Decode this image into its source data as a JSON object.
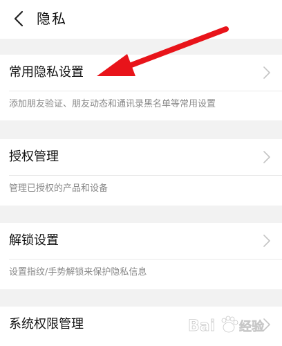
{
  "header": {
    "back_icon": "chevron-left-icon",
    "title": "隐私"
  },
  "sections": [
    {
      "label": "常用隐私设置",
      "description": "添加朋友验证、朋友动态和通讯录黑名单等常用设置"
    },
    {
      "label": "授权管理",
      "description": "管理已授权的产品和设备"
    },
    {
      "label": "解锁设置",
      "description": "设置指纹/手势解锁来保护隐私信息"
    },
    {
      "label": "系统权限管理",
      "description": ""
    }
  ],
  "annotation": {
    "type": "arrow",
    "color": "#e8141a",
    "points_to": "常用隐私设置"
  },
  "watermark": {
    "text": "Bai",
    "paw": "du",
    "sub": "经验"
  },
  "colors": {
    "background": "#f2f2f2",
    "card": "#ffffff",
    "text_primary": "#111111",
    "text_secondary": "#888888",
    "chevron": "#c4c4c4"
  }
}
